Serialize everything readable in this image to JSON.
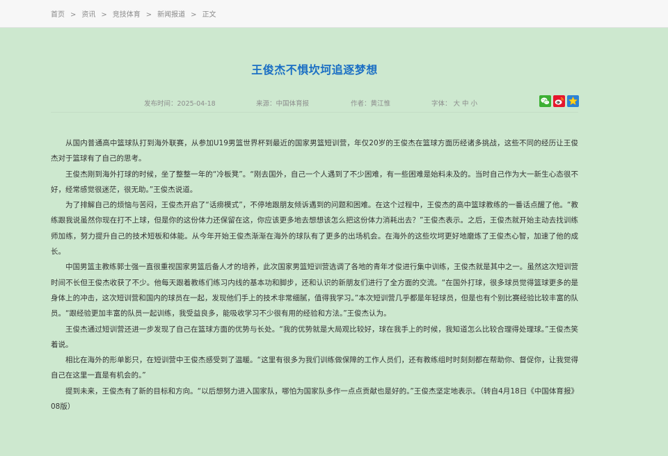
{
  "breadcrumb": {
    "items": [
      "首页",
      "资讯",
      "竞技体育",
      "新闻报道",
      "正文"
    ],
    "separator": ">"
  },
  "article": {
    "title": "王俊杰不惧坎坷追逐梦想",
    "meta": {
      "date": "发布时间：2025-04-18",
      "source": "来源：中国体育报",
      "author": "作者：黄江惟",
      "font_label": "字体：",
      "font_sizes": [
        "大",
        "中",
        "小"
      ]
    },
    "share_icons": [
      "wechat-icon",
      "weibo-icon",
      "favorite-star-icon"
    ],
    "paragraphs": [
      "从国内普通高中篮球队打到海外联赛，从参加U19男篮世界杯到最近的国家男篮短训营，年仅20岁的王俊杰在篮球方面历经诸多挑战，这些不同的经历让王俊杰对于篮球有了自己的思考。",
      "王俊杰刚到海外打球的时候，坐了整整一年的“冷板凳”。“刚去国外，自己一个人遇到了不少困难，有一些困难是始料未及的。当时自己作为大一新生心态很不好，经常感觉很迷茫，很无助。”王俊杰说道。",
      "为了排解自己的烦恼与苦闷，王俊杰开启了“话痨模式”，不停地跟朋友倾诉遇到的问题和困难。在这个过程中，王俊杰的高中篮球教练的一番话点醒了他。“教练跟我说虽然你现在打不上球，但是你的这份体力还保留在这，你应该更多地去想想该怎么把这份体力消耗出去？”王俊杰表示。之后，王俊杰就开始主动去找训练师加练，努力提升自己的技术短板和体能。从今年开始王俊杰渐渐在海外的球队有了更多的出场机会。在海外的这些坎坷更好地磨炼了王俊杰心智，加速了他的成长。",
      "中国男篮主教练郭士强一直很重视国家男篮后备人才的培养，此次国家男篮短训营选调了各地的青年才俊进行集中训练，王俊杰就是其中之一。虽然这次短训营时间不长但王俊杰收获了不少。他每天跟着教练们练习内线的基本功和脚步，还和认识的新朋友们进行了全方面的交流。“在国外打球，很多球员觉得篮球更多的是身体上的冲击，这次短训营和国内的球员在一起，发现他们手上的技术非常细腻，值得我学习。”本次短训营几乎都是年轻球员，但是也有个别比赛经验比较丰富的队员。“跟经验更加丰富的队员一起训练，我受益良多，能吸收学习不少很有用的经验和方法。”王俊杰认为。",
      "王俊杰通过短训营还进一步发现了自己在篮球方面的优势与长处。“我的优势就是大局观比较好，球在我手上的时候，我知道怎么比较合理得处理球。”王俊杰笑着说。",
      "相比在海外的形单影只，在短训营中王俊杰感受到了温暖。“这里有很多为我们训练做保障的工作人员们，还有教练组时时刻刻都在帮助你、督促你，让我觉得自己在这里一直是有机会的。”",
      "提到未来，王俊杰有了新的目标和方向。“以后想努力进入国家队，哪怕为国家队多作一点点贡献也是好的。”王俊杰坚定地表示。（转自4月18日《中国体育报》08版）"
    ]
  },
  "colors": {
    "page_background": "#cde8cf",
    "topbar_background": "#f7f7f7",
    "title": "#1b6fc4",
    "meta_text": "#8c8c8c",
    "body_text": "#333333",
    "wechat": "#3cb034",
    "weibo": "#e6162d",
    "favorite": "#2c83d6"
  }
}
